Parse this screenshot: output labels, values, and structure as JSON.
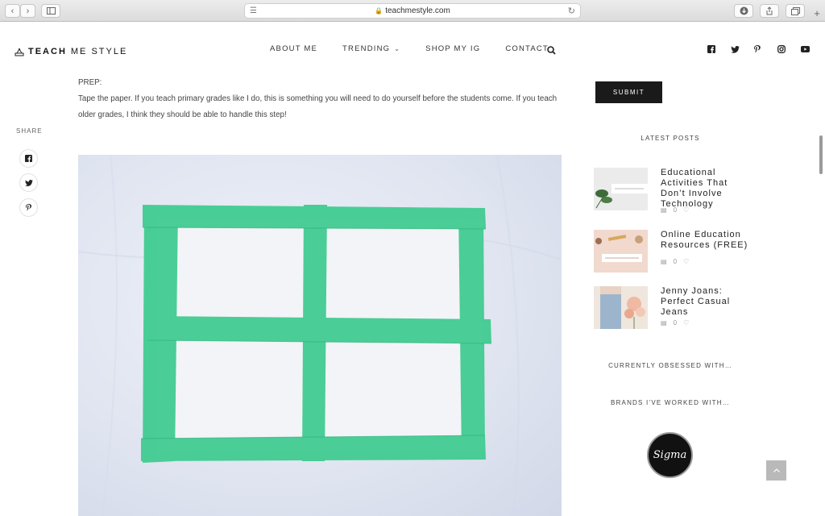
{
  "browser": {
    "url": "teachmestyle.com",
    "back_icon": "‹",
    "forward_icon": "›",
    "new_tab": "+"
  },
  "header": {
    "logo_bold": "TEACH",
    "logo_rest": "ME STYLE",
    "nav": [
      "ABOUT ME",
      "TRENDING",
      "SHOP MY IG",
      "CONTACT"
    ],
    "social_icons": [
      "facebook-icon",
      "twitter-icon",
      "pinterest-icon",
      "instagram-icon",
      "youtube-icon"
    ]
  },
  "share": {
    "label": "SHARE",
    "buttons": [
      "facebook",
      "twitter",
      "pinterest"
    ]
  },
  "article": {
    "prep_label": "PREP:",
    "paragraph": "Tape the paper.  If you teach primary grades like I do, this is something you will need to do yourself before the students come.  If you teach older grades, I think they should be able to handle this step!"
  },
  "sidebar": {
    "submit_label": "SUBMIT",
    "latest_heading": "LATEST POSTS",
    "posts": [
      {
        "title": "Educational Activities That Don’t Involve Technology",
        "comments": "0"
      },
      {
        "title": "Online Education Resources (FREE)",
        "comments": "0"
      },
      {
        "title": "Jenny Joans: Perfect Casual Jeans",
        "comments": "0"
      }
    ],
    "obsessed_heading": "CURRENTLY OBSESSED WITH…",
    "brands_heading": "BRANDS I’VE WORKED WITH…",
    "brand_name": "Sigma"
  },
  "colors": {
    "tape": "#3ecb8f",
    "accent_dark": "#1a1a1a"
  }
}
